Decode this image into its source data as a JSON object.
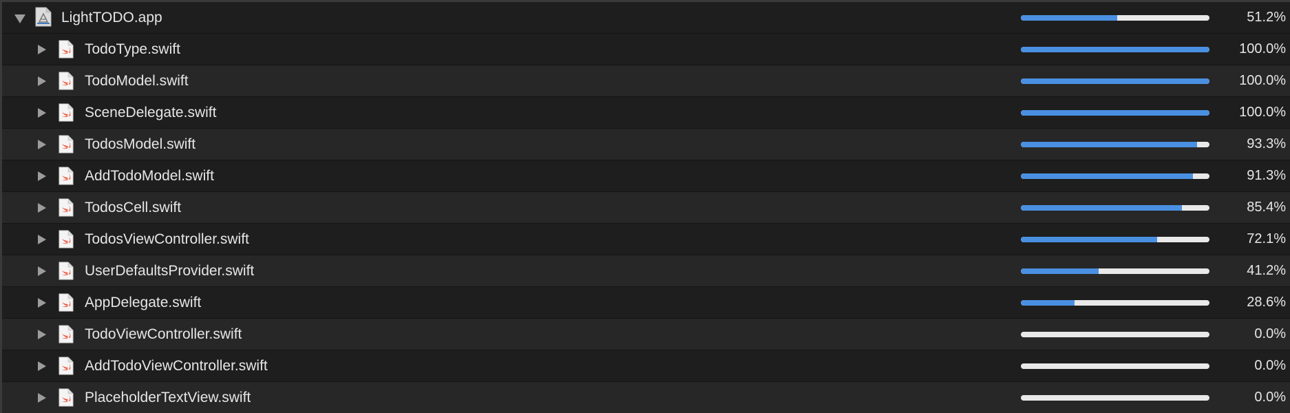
{
  "colors": {
    "bar_fill": "#4a90e2",
    "bar_track": "#e9e9e9",
    "text": "#e6e6e6",
    "row_even": "#272727",
    "row_odd": "#1e1e1e"
  },
  "root": {
    "name": "LightTODO.app",
    "coverage": 0.512,
    "coverage_label": "51.2%",
    "icon": "app-bundle-icon",
    "expanded": true
  },
  "files": [
    {
      "name": "TodoType.swift",
      "coverage": 1.0,
      "coverage_label": "100.0%",
      "icon": "swift-file-icon"
    },
    {
      "name": "TodoModel.swift",
      "coverage": 1.0,
      "coverage_label": "100.0%",
      "icon": "swift-file-icon"
    },
    {
      "name": "SceneDelegate.swift",
      "coverage": 1.0,
      "coverage_label": "100.0%",
      "icon": "swift-file-icon"
    },
    {
      "name": "TodosModel.swift",
      "coverage": 0.933,
      "coverage_label": "93.3%",
      "icon": "swift-file-icon"
    },
    {
      "name": "AddTodoModel.swift",
      "coverage": 0.913,
      "coverage_label": "91.3%",
      "icon": "swift-file-icon"
    },
    {
      "name": "TodosCell.swift",
      "coverage": 0.854,
      "coverage_label": "85.4%",
      "icon": "swift-file-icon"
    },
    {
      "name": "TodosViewController.swift",
      "coverage": 0.721,
      "coverage_label": "72.1%",
      "icon": "swift-file-icon"
    },
    {
      "name": "UserDefaultsProvider.swift",
      "coverage": 0.412,
      "coverage_label": "41.2%",
      "icon": "swift-file-icon"
    },
    {
      "name": "AppDelegate.swift",
      "coverage": 0.286,
      "coverage_label": "28.6%",
      "icon": "swift-file-icon"
    },
    {
      "name": "TodoViewController.swift",
      "coverage": 0.0,
      "coverage_label": "0.0%",
      "icon": "swift-file-icon"
    },
    {
      "name": "AddTodoViewController.swift",
      "coverage": 0.0,
      "coverage_label": "0.0%",
      "icon": "swift-file-icon"
    },
    {
      "name": "PlaceholderTextView.swift",
      "coverage": 0.0,
      "coverage_label": "0.0%",
      "icon": "swift-file-icon"
    }
  ]
}
